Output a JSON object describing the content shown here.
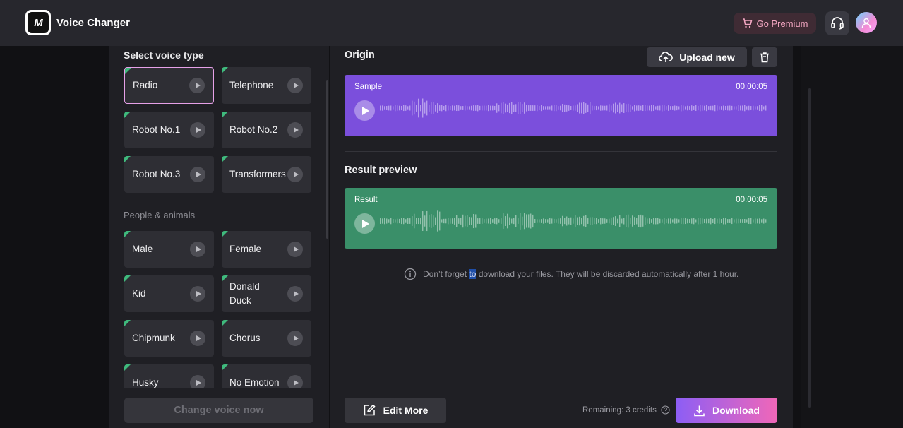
{
  "header": {
    "logo_text": "M",
    "app_title": "Voice Changer",
    "premium_label": "Go Premium",
    "support_icon": "headset-icon",
    "avatar_icon": "user-icon"
  },
  "left": {
    "section_title": "Select voice type",
    "group_people": "People & animals",
    "voices_top": [
      {
        "label": "Radio",
        "selected": true
      },
      {
        "label": "Telephone"
      },
      {
        "label": "Robot No.1"
      },
      {
        "label": "Robot No.2"
      },
      {
        "label": "Robot No.3"
      },
      {
        "label": "Transformers"
      }
    ],
    "voices_people": [
      {
        "label": "Male"
      },
      {
        "label": "Female"
      },
      {
        "label": "Kid"
      },
      {
        "label": "Donald Duck"
      },
      {
        "label": "Chipmunk"
      },
      {
        "label": "Chorus"
      },
      {
        "label": "Husky"
      },
      {
        "label": "No Emotion"
      }
    ],
    "change_button": "Change voice now"
  },
  "right": {
    "origin_title": "Origin",
    "upload_label": "Upload new",
    "sample": {
      "label": "Sample",
      "time": "00:00:05"
    },
    "result_title": "Result preview",
    "result": {
      "label": "Result",
      "time": "00:00:05"
    },
    "notice_before": "Don’t forget ",
    "notice_highlight": "to",
    "notice_after": " download your files. They will be discarded automatically after 1 hour.",
    "edit_label": "Edit More",
    "remaining_label": "Remaining: 3 credits",
    "download_label": "Download"
  },
  "colors": {
    "sample_card": "#7b4fdc",
    "result_card": "#3a8f69",
    "selected_border": "#e6a0e8",
    "premium_text": "#f2a6c1"
  }
}
